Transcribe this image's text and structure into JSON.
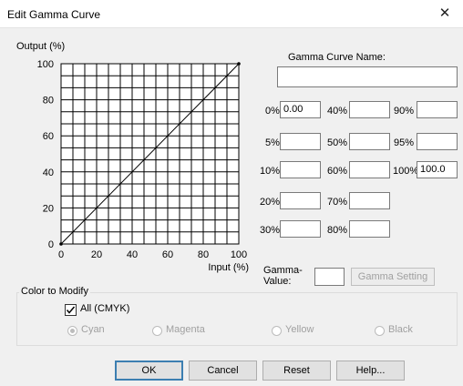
{
  "window": {
    "title": "Edit Gamma Curve"
  },
  "chart": {
    "ylabel": "Output (%)",
    "xlabel": "Input (%)",
    "yticks": [
      "100",
      "80",
      "60",
      "40",
      "20",
      "0"
    ],
    "xticks": [
      "0",
      "20",
      "40",
      "60",
      "80",
      "100"
    ]
  },
  "chart_data": {
    "type": "line",
    "title": "",
    "xlabel": "Input (%)",
    "ylabel": "Output (%)",
    "xlim": [
      0,
      100
    ],
    "ylim": [
      0,
      100
    ],
    "grid": true,
    "series": [
      {
        "x": [
          0,
          100
        ],
        "y": [
          0,
          100
        ]
      }
    ]
  },
  "curve_name": {
    "label": "Gamma Curve Name:",
    "value": ""
  },
  "points": {
    "p0": {
      "label": "0%",
      "value": "0.00"
    },
    "p5": {
      "label": "5%",
      "value": ""
    },
    "p10": {
      "label": "10%",
      "value": ""
    },
    "p20": {
      "label": "20%",
      "value": ""
    },
    "p30": {
      "label": "30%",
      "value": ""
    },
    "p40": {
      "label": "40%",
      "value": ""
    },
    "p50": {
      "label": "50%",
      "value": ""
    },
    "p60": {
      "label": "60%",
      "value": ""
    },
    "p70": {
      "label": "70%",
      "value": ""
    },
    "p80": {
      "label": "80%",
      "value": ""
    },
    "p90": {
      "label": "90%",
      "value": ""
    },
    "p95": {
      "label": "95%",
      "value": ""
    },
    "p100": {
      "label": "100%",
      "value": "100.0"
    }
  },
  "gamma": {
    "label_line1": "Gamma-",
    "label_line2": "Value:",
    "value": "",
    "setting_button": "Gamma Setting"
  },
  "color_group": {
    "title": "Color to Modify",
    "all_label": "All (CMYK)",
    "all_checked": true,
    "cyan": "Cyan",
    "magenta": "Magenta",
    "yellow": "Yellow",
    "black": "Black"
  },
  "buttons": {
    "ok": "OK",
    "cancel": "Cancel",
    "reset": "Reset",
    "help": "Help..."
  }
}
